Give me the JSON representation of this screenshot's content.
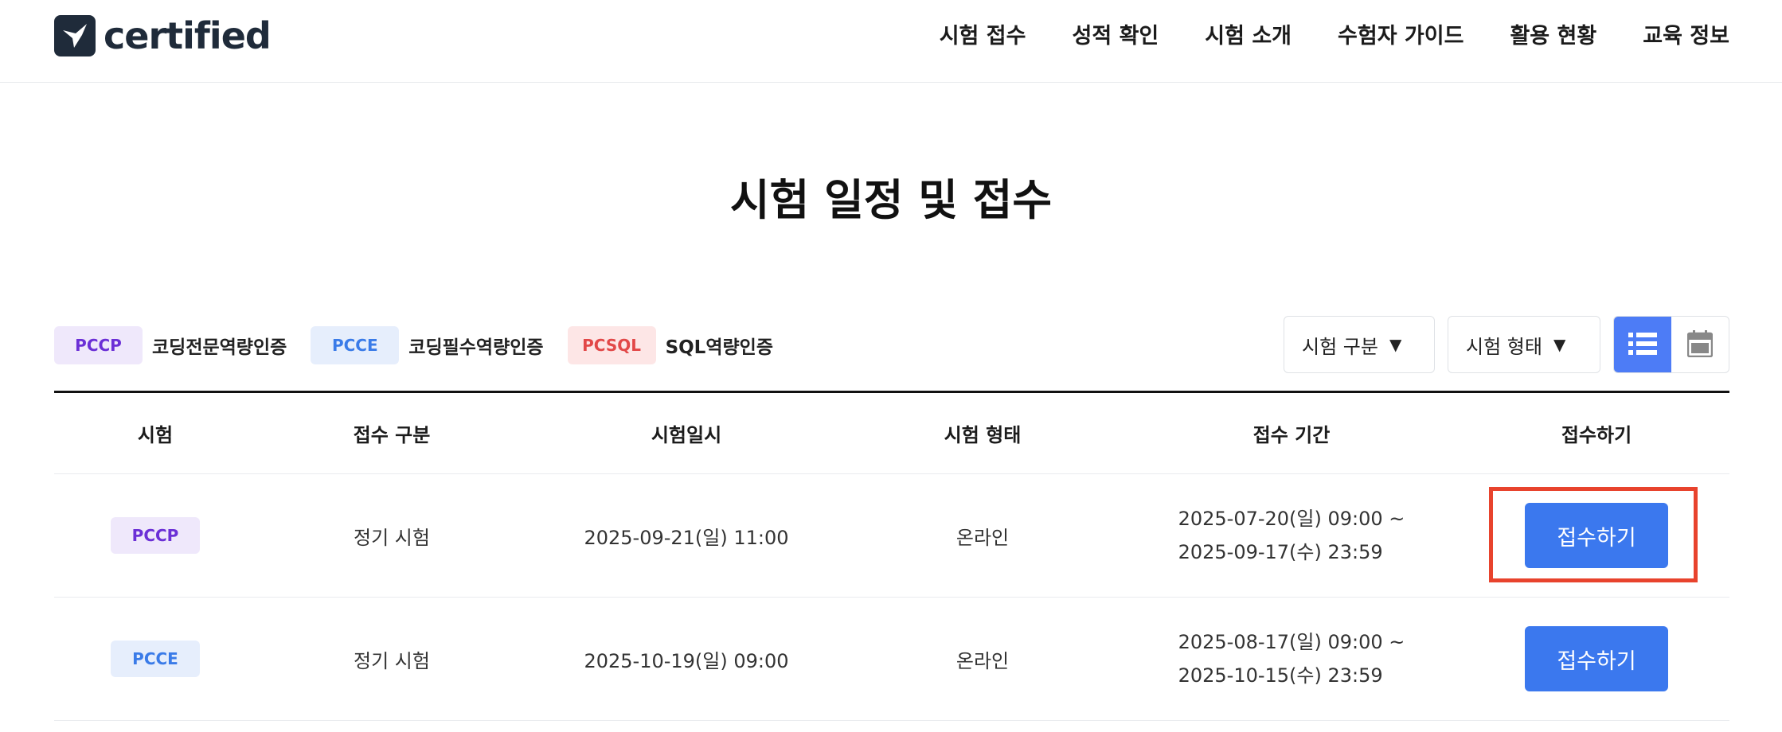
{
  "header": {
    "logo_text": "certified",
    "nav": [
      "시험 접수",
      "성적 확인",
      "시험 소개",
      "수험자 가이드",
      "활용 현황",
      "교육 정보"
    ]
  },
  "page_title": "시험 일정 및 접수",
  "legend": [
    {
      "code": "PCCP",
      "label": "코딩전문역량인증"
    },
    {
      "code": "PCCE",
      "label": "코딩필수역량인증"
    },
    {
      "code": "PCSQL",
      "label": "SQL역량인증"
    }
  ],
  "filters": {
    "exam_type": "시험 구분",
    "exam_form": "시험 형태"
  },
  "view_toggle": {
    "list_icon": "list-icon",
    "calendar_icon": "calendar-icon",
    "active": "list"
  },
  "table": {
    "headers": [
      "시험",
      "접수 구분",
      "시험일시",
      "시험 형태",
      "접수 기간",
      "접수하기"
    ],
    "rows": [
      {
        "exam": "PCCP",
        "category": "정기 시험",
        "datetime": "2025-09-21(일) 11:00",
        "form": "온라인",
        "period_start": "2025-07-20(일) 09:00 ~",
        "period_end": "2025-09-17(수) 23:59",
        "action": "접수하기"
      },
      {
        "exam": "PCCE",
        "category": "정기 시험",
        "datetime": "2025-10-19(일) 09:00",
        "form": "온라인",
        "period_start": "2025-08-17(일) 09:00 ~",
        "period_end": "2025-10-15(수) 23:59",
        "action": "접수하기"
      }
    ]
  },
  "colors": {
    "accent": "#3b78ee",
    "highlight": "#e8432d",
    "pccp": "#6b2fd6",
    "pcce": "#3a7be8",
    "pcsql": "#e24848"
  }
}
